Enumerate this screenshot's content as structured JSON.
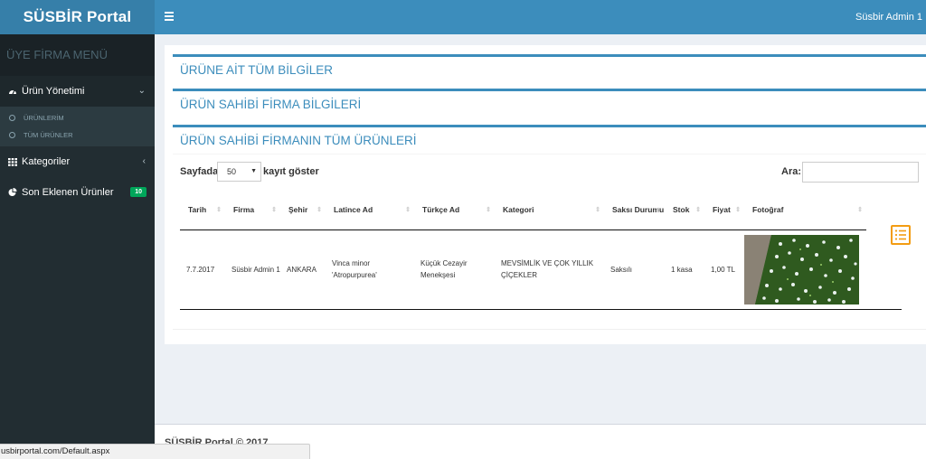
{
  "header": {
    "logo": "SÜSBİR Portal",
    "user_name": "Süsbir Admin 1"
  },
  "sidebar": {
    "menu_header": "ÜYE FİRMA MENÜ",
    "items": [
      {
        "label": "Ürün Yönetimi",
        "icon": "dashboard-icon"
      },
      {
        "label": "Kategoriler",
        "icon": "grid-icon"
      },
      {
        "label": "Son Eklenen Ürünler",
        "icon": "pie-chart-icon",
        "badge": "10"
      }
    ],
    "sub_items": [
      "ÜRÜNLERİM",
      "TÜM ÜRÜNLER"
    ]
  },
  "boxes": {
    "product_info": "ÜRÜNE AİT TÜM BİLGİLER",
    "owner_info": "ÜRÜN SAHİBİ FİRMA BİLGİLERİ",
    "owner_products": "ÜRÜN SAHİBİ FİRMANIN TÜM ÜRÜNLERİ"
  },
  "table_controls": {
    "length_prefix": "Sayfada",
    "length_value": "50",
    "length_suffix": "kayıt göster",
    "search_label": "Ara:",
    "search_value": ""
  },
  "table": {
    "columns": [
      "Tarih",
      "Firma",
      "Şehir",
      "Latince Ad",
      "Türkçe Ad",
      "Kategori",
      "Saksı Durumu",
      "Stok",
      "Fiyat",
      "Fotoğraf"
    ],
    "rows": [
      {
        "tarih": "7.7.2017",
        "firma": "Süsbir Admin 1",
        "sehir": "ANKARA",
        "latince": "Vinca minor 'Atropurpurea'",
        "turkce": "Küçük Cezayir Menekşesi",
        "kategori": "MEVSİMLİK VE ÇOK YILLIK ÇİÇEKLER",
        "saksi": "Saksılı",
        "stok": "1 kasa",
        "fiyat": "1,00 TL"
      }
    ]
  },
  "footer": {
    "text": "SÜSBİR Portal © 2017"
  },
  "statusbar": {
    "url": "usbirportal.com/Default.aspx"
  },
  "colors": {
    "primary": "#3c8dbc",
    "logo_bg": "#367fa9",
    "sidebar_bg": "#222d32",
    "badge": "#00a65a",
    "detail_icon": "#f39c12"
  }
}
